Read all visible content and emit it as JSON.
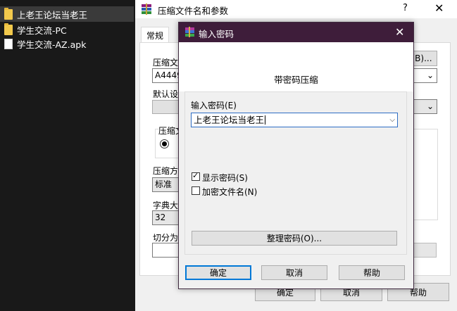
{
  "explorer": {
    "items": [
      {
        "name": "上老王论坛当老王",
        "type": "folder",
        "selected": true
      },
      {
        "name": "学生交流-PC",
        "type": "folder",
        "selected": false
      },
      {
        "name": "学生交流-AZ.apk",
        "type": "file",
        "selected": false
      }
    ]
  },
  "archive_dialog": {
    "title": "压缩文件名和参数",
    "help_icon": "?",
    "tab_general": "常规",
    "archive_name_label": "压缩文",
    "archive_name_value": "A4449",
    "browse_button": "(B)...",
    "default_settings_label": "默认设",
    "format_label": "压缩文",
    "method_label": "压缩方",
    "method_value": "标准",
    "dict_label": "字典大",
    "dict_value": "32",
    "split_label": "切分为",
    "ok_button": "确定",
    "cancel_button": "取消",
    "help_button": "帮助"
  },
  "password_dialog": {
    "title": "输入密码",
    "heading": "带密码压缩",
    "password_label": "输入密码(E)",
    "password_value": "上老王论坛当老王",
    "show_password_label": "显示密码(S)",
    "show_password_checked": true,
    "encrypt_names_label": "加密文件名(N)",
    "encrypt_names_checked": false,
    "organize_button": "整理密码(O)...",
    "ok_button": "确定",
    "cancel_button": "取消",
    "help_button": "帮助"
  },
  "colors": {
    "titlebar_dark": "#3e1d3a",
    "default_button_border": "#0078d7",
    "explorer_bg": "#191919",
    "folder": "#f2c94c"
  }
}
